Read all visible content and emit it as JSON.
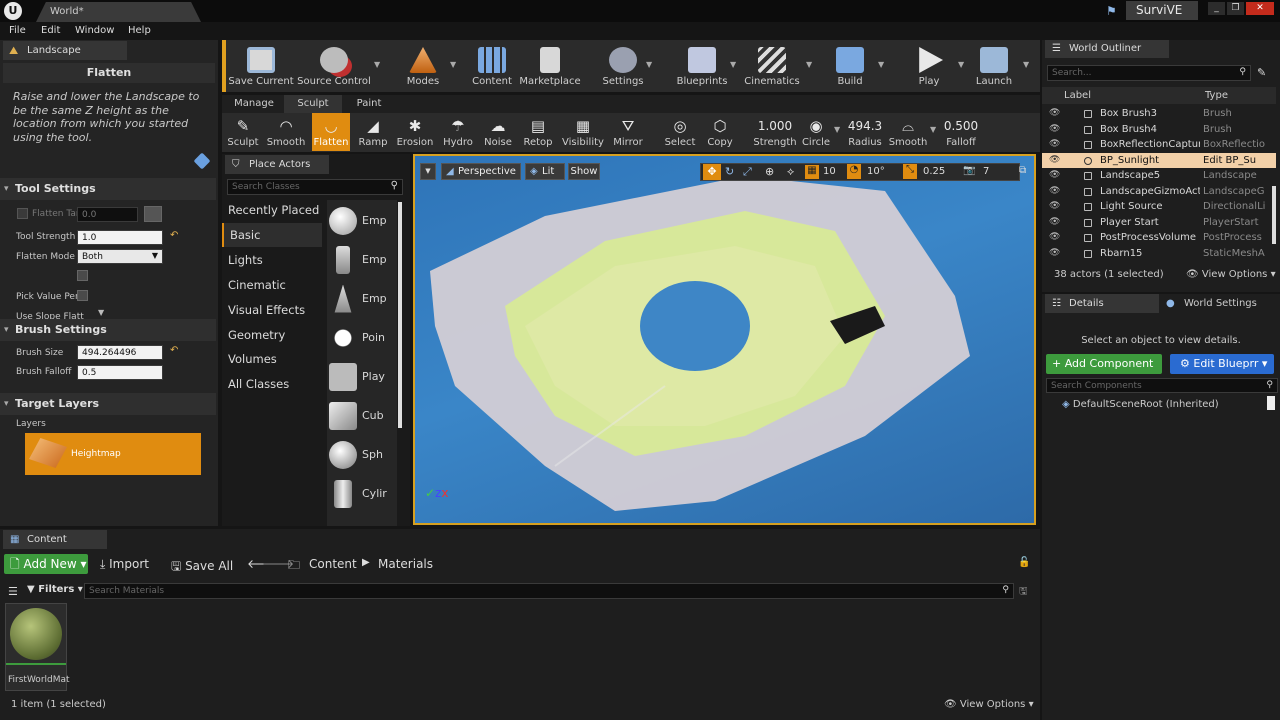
{
  "title_bar": {
    "tab_label": "World",
    "tab_dirty": "*",
    "app_badge": "SurviVE"
  },
  "menu": [
    "File",
    "Edit",
    "Window",
    "Help"
  ],
  "mode_panel": {
    "tab_label": "Landscape",
    "tool_title": "Flatten",
    "description": "Raise and lower the Landscape to be the same Z height as the location from which you started using the tool.",
    "tool_settings": {
      "header": "Tool Settings",
      "flatten_target_label": "Flatten Tar",
      "flatten_target_value": "0.0",
      "tool_strength_label": "Tool Strength",
      "tool_strength_value": "1.0",
      "flatten_mode_label": "Flatten Mode",
      "flatten_mode_value": "Both",
      "use_slope_label": "Use Slope Flatt",
      "pick_value_label": "Pick Value Per"
    },
    "brush_settings": {
      "header": "Brush Settings",
      "size_label": "Brush Size",
      "size_value": "494.264496",
      "falloff_label": "Brush Falloff",
      "falloff_value": "0.5"
    },
    "target_layers": {
      "header": "Target Layers",
      "layers_label": "Layers",
      "layer_name": "Heightmap"
    }
  },
  "toolbar": [
    {
      "label": "Save Current",
      "icon": "save-icon"
    },
    {
      "label": "Source Control",
      "icon": "source-control-icon"
    },
    {
      "label": "Modes",
      "icon": "modes-icon"
    },
    {
      "label": "Content",
      "icon": "content-icon"
    },
    {
      "label": "Marketplace",
      "icon": "marketplace-icon"
    },
    {
      "label": "Settings",
      "icon": "settings-icon"
    },
    {
      "label": "Blueprints",
      "icon": "blueprints-icon"
    },
    {
      "label": "Cinematics",
      "icon": "cinematics-icon"
    },
    {
      "label": "Build",
      "icon": "build-icon"
    },
    {
      "label": "Play",
      "icon": "play-icon"
    },
    {
      "label": "Launch",
      "icon": "launch-icon"
    }
  ],
  "landscape_tabs": [
    "Manage",
    "Sculpt",
    "Paint"
  ],
  "sculpt_tools": [
    "Sculpt",
    "Smooth",
    "Flatten",
    "Ramp",
    "Erosion",
    "Hydro",
    "Noise",
    "Retop",
    "Visibility",
    "Mirror",
    "Select",
    "Copy"
  ],
  "brush_strip": {
    "strength_value": "1.000",
    "strength_label": "Strength",
    "shape_label": "Circle",
    "radius_value": "494.3",
    "radius_label": "Radius",
    "smooth_label": "Smooth",
    "falloff_value": "0.500",
    "falloff_label": "Falloff"
  },
  "place_actors": {
    "tab_label": "Place Actors",
    "search_placeholder": "Search Classes",
    "categories": [
      "Recently Placed",
      "Basic",
      "Lights",
      "Cinematic",
      "Visual Effects",
      "Geometry",
      "Volumes",
      "All Classes"
    ],
    "items": [
      "Emp",
      "Emp",
      "Emp",
      "Poin",
      "Play",
      "Cub",
      "Sph",
      "Cylir"
    ]
  },
  "viewport": {
    "perspective": "Perspective",
    "lit": "Lit",
    "show": "Show",
    "grid_snap": "10",
    "rot_snap": "10°",
    "scale_snap": "0.25",
    "cam_speed": "7"
  },
  "outliner": {
    "tab_label": "World Outliner",
    "search_placeholder": "Search...",
    "col_label": "Label",
    "col_type": "Type",
    "rows": [
      {
        "label": "Box Brush3",
        "type": "Brush"
      },
      {
        "label": "Box Brush4",
        "type": "Brush"
      },
      {
        "label": "BoxReflectionCapture",
        "type": "BoxReflectio"
      },
      {
        "label": "BP_Sunlight",
        "type": "Edit BP_Su"
      },
      {
        "label": "Landscape5",
        "type": "Landscape"
      },
      {
        "label": "LandscapeGizmoActiv",
        "type": "LandscapeG"
      },
      {
        "label": "Light Source",
        "type": "DirectionalLi"
      },
      {
        "label": "Player Start",
        "type": "PlayerStart"
      },
      {
        "label": "PostProcessVolume",
        "type": "PostProcess"
      },
      {
        "label": "Rbarn15",
        "type": "StaticMeshA"
      }
    ],
    "status": "38 actors (1 selected)",
    "view_options": "View Options"
  },
  "details": {
    "tab_label": "Details",
    "world_settings": "World Settings",
    "hint": "Select an object to view details.",
    "add_component": "Add Component",
    "edit_blueprint": "Edit Blueprr",
    "search_placeholder": "Search Components",
    "root": "DefaultSceneRoot (Inherited)"
  },
  "content_browser": {
    "tab_label": "Content Browser",
    "add_new": "Add New",
    "import": "Import",
    "save_all": "Save All",
    "crumb1": "Content",
    "crumb2": "Materials",
    "filters": "Filters",
    "search_placeholder": "Search Materials",
    "asset_name": "FirstWorldMat",
    "status": "1 item (1 selected)",
    "view_options": "View Options"
  },
  "colors": {
    "accent_orange": "#e08c10",
    "green": "#3d9b3d",
    "blue": "#2a6bd1"
  }
}
